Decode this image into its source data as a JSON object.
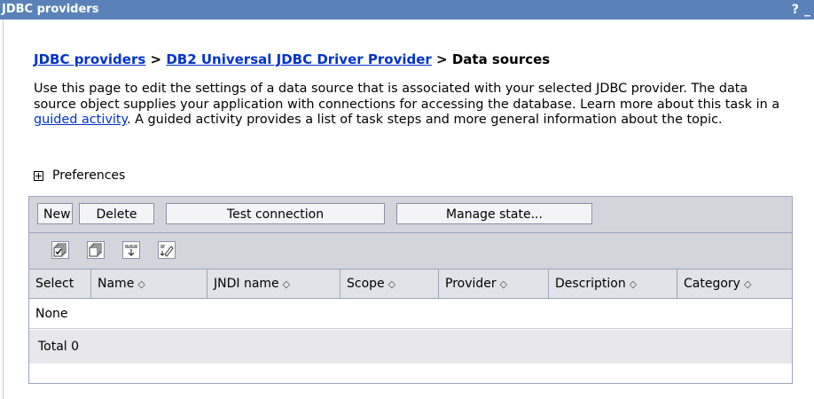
{
  "window": {
    "title": "JDBC providers",
    "help_label": "?",
    "minimize_label": "_"
  },
  "breadcrumb": {
    "link1": "JDBC providers",
    "sep1": " > ",
    "link2": "DB2 Universal JDBC Driver Provider",
    "sep2": " > ",
    "current": "Data sources"
  },
  "description": {
    "text_before": "Use this page to edit the settings of a data source that is associated with your selected JDBC provider. The data source object supplies your application with connections for accessing the database. Learn more about this task in a ",
    "link": "guided activity",
    "text_after": ". A guided activity provides a list of task steps and more general information about the topic."
  },
  "preferences": {
    "label": "Preferences",
    "icon": "expand-plus-icon"
  },
  "toolbar": {
    "buttons": [
      "New",
      "Delete",
      "Test connection",
      "Manage state..."
    ],
    "icons": [
      "select-all-icon",
      "deselect-all-icon",
      "show-filter-icon",
      "clear-filter-icon"
    ]
  },
  "table": {
    "columns": [
      "Select",
      "Name",
      "JNDI name",
      "Scope",
      "Provider",
      "Description",
      "Category"
    ],
    "sort_glyph": "◇",
    "empty_text": "None",
    "total_text": "Total 0"
  },
  "colors": {
    "titlebar": "#5a82b8",
    "link": "#0033cc",
    "toolbar_bg": "#d4d4dd",
    "border": "#9aa6bd"
  }
}
